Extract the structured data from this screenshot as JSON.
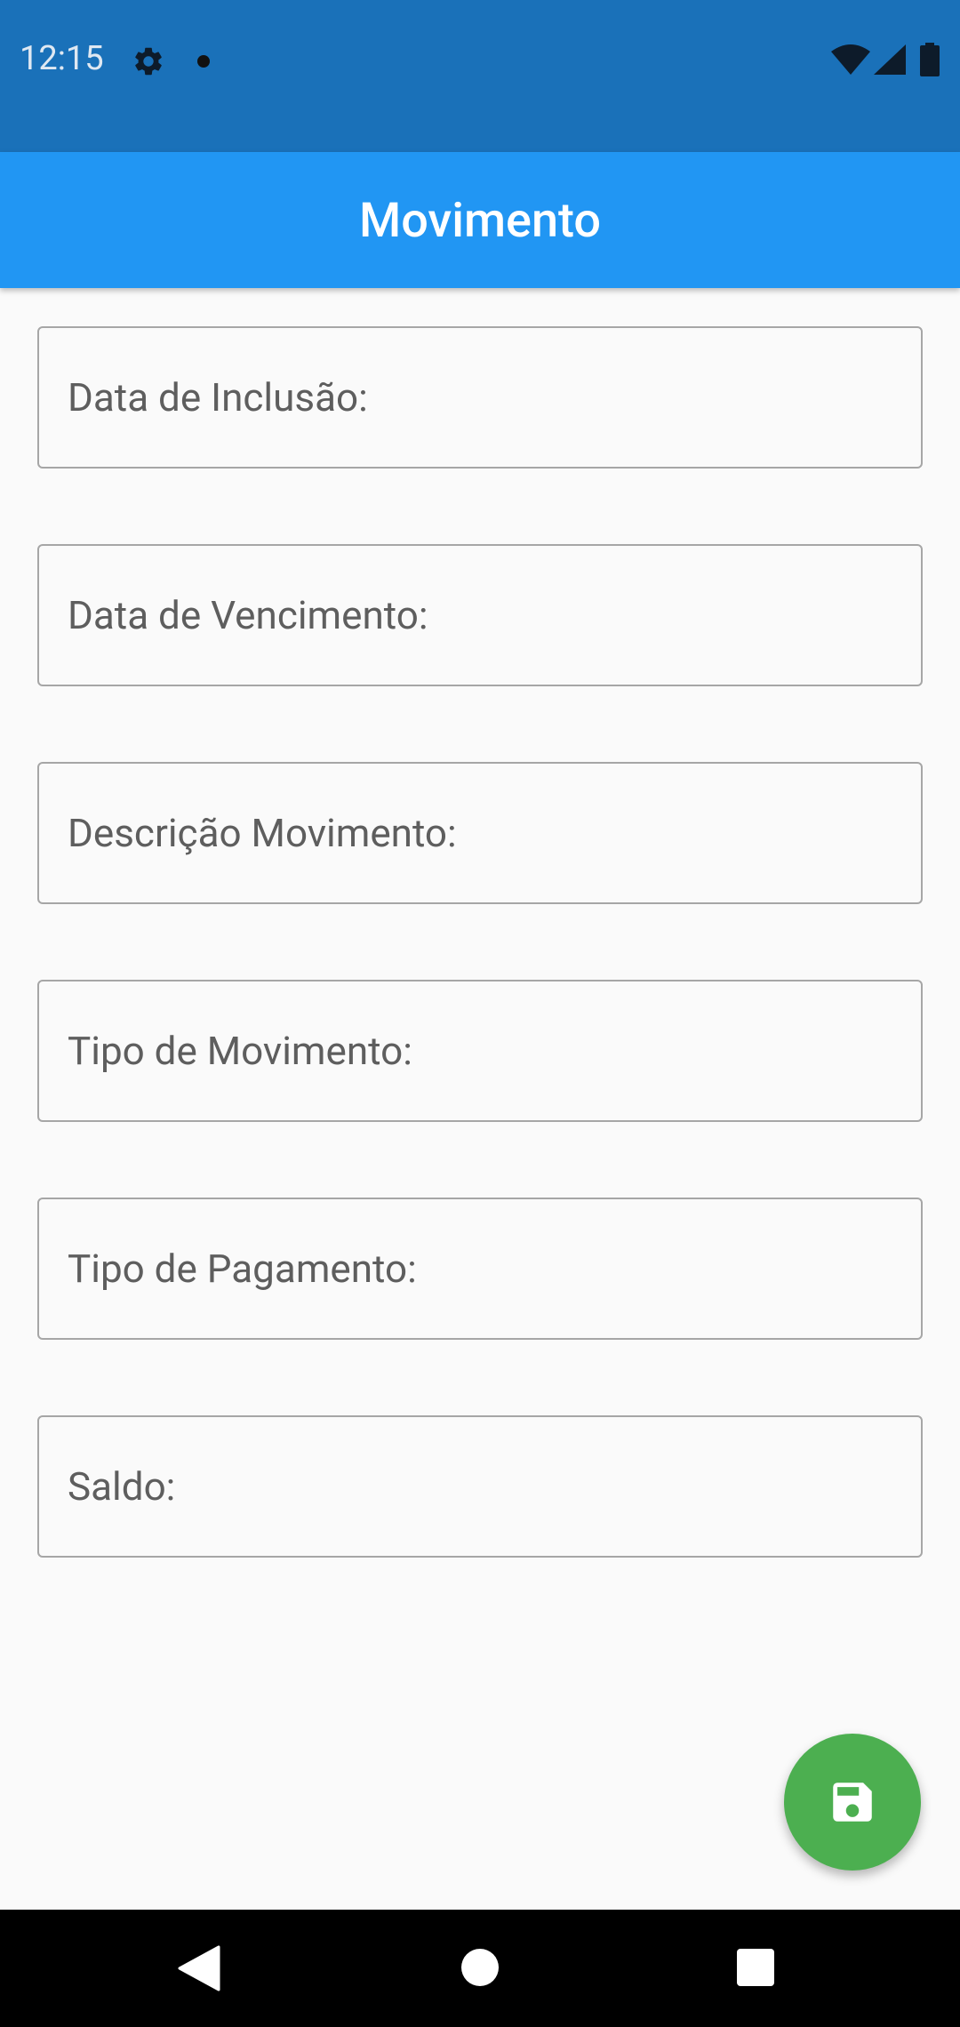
{
  "status_bar": {
    "time": "12:15",
    "icons": [
      "gear-icon",
      "notification-dot-icon",
      "wifi-icon",
      "signal-icon",
      "battery-icon"
    ]
  },
  "app_bar": {
    "title": "Movimento",
    "color": "#2196f3"
  },
  "form": {
    "fields": [
      {
        "label": "Data de Inclusão:",
        "value": ""
      },
      {
        "label": "Data de Vencimento:",
        "value": ""
      },
      {
        "label": "Descrição Movimento:",
        "value": ""
      },
      {
        "label": "Tipo de Movimento:",
        "value": ""
      },
      {
        "label": "Tipo de Pagamento:",
        "value": ""
      },
      {
        "label": "Saldo:",
        "value": ""
      }
    ]
  },
  "fab": {
    "icon": "save-icon",
    "color": "#4caf50"
  },
  "nav_bar": {
    "icons": [
      "back-icon",
      "home-icon",
      "recents-icon"
    ]
  }
}
